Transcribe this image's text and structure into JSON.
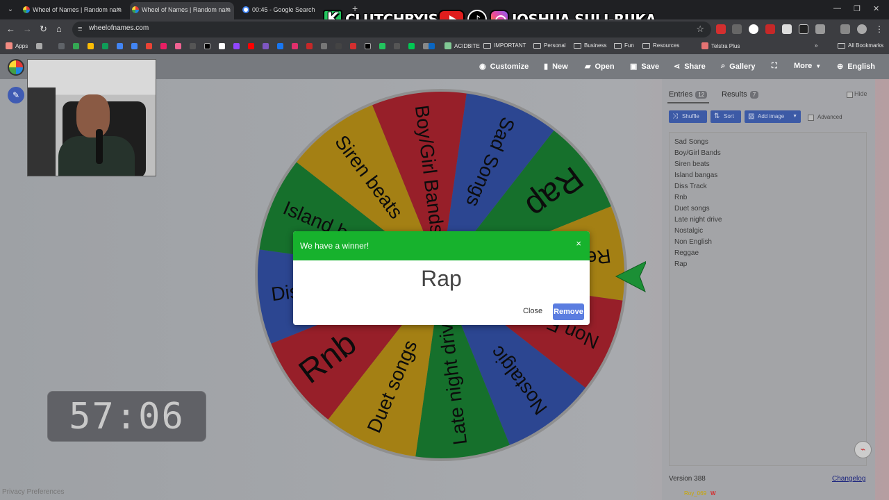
{
  "browser": {
    "tabs": [
      {
        "title": "Wheel of Names | Random nam"
      },
      {
        "title": "Wheel of Names | Random nam"
      },
      {
        "title": "00:45 - Google Search"
      }
    ],
    "url": "wheelofnames.com",
    "bookmarks": [
      "Apps",
      "ACIDBITE",
      "IMPORTANT",
      "Personal",
      "Business",
      "Fun",
      "Resources",
      "Telstra Plus",
      "All Bookmarks"
    ]
  },
  "banner": {
    "left_text": "CLUTCHBYJSR",
    "right_text": "JOSHUA SULI-RUKA"
  },
  "app": {
    "menu": [
      "Customize",
      "New",
      "Open",
      "Save",
      "Share",
      "Gallery",
      "More",
      "English"
    ]
  },
  "wheel": {
    "segments": [
      {
        "label": "Sad Songs",
        "color": "#3e62c9"
      },
      {
        "label": "Rap",
        "color": "#1f9c3d"
      },
      {
        "label": "Reggae",
        "color": "#e3b21d"
      },
      {
        "label": "Non English",
        "color": "#d12b3a"
      },
      {
        "label": "Nostalgic",
        "color": "#3e62c9"
      },
      {
        "label": "Late night drive",
        "color": "#1f9c3d"
      },
      {
        "label": "Duet songs",
        "color": "#e3b21d"
      },
      {
        "label": "Rnb",
        "color": "#d12b3a"
      },
      {
        "label": "Diss Track",
        "color": "#3e62c9"
      },
      {
        "label": "Island bangas",
        "color": "#1f9c3d"
      },
      {
        "label": "Siren beats",
        "color": "#e3b21d"
      },
      {
        "label": "Boy/Girl Bands",
        "color": "#d12b3a"
      }
    ]
  },
  "sidebar": {
    "entries_tab": "Entries",
    "entries_count": "12",
    "results_tab": "Results",
    "results_count": "7",
    "hide_label": "Hide",
    "buttons": {
      "shuffle": "Shuffle",
      "sort": "Sort",
      "add_image": "Add image"
    },
    "advanced_label": "Advanced",
    "entries": [
      "Sad Songs",
      "Boy/Girl Bands",
      "Siren beats",
      "Island bangas",
      "Diss Track",
      "Rnb",
      "Duet songs",
      "Late night drive",
      "Nostalgic",
      "Non English",
      "Reggae",
      "Rap"
    ],
    "version": "Version 388",
    "changelog": "Changelog"
  },
  "timer": "57:06",
  "privacy": "Privacy Preferences",
  "dialog": {
    "title": "We have a winner!",
    "winner": "Rap",
    "close_label": "Close",
    "remove_label": "Remove",
    "close_icon": "×"
  },
  "chat": {
    "user": "Roy_069",
    "msg": "W"
  }
}
